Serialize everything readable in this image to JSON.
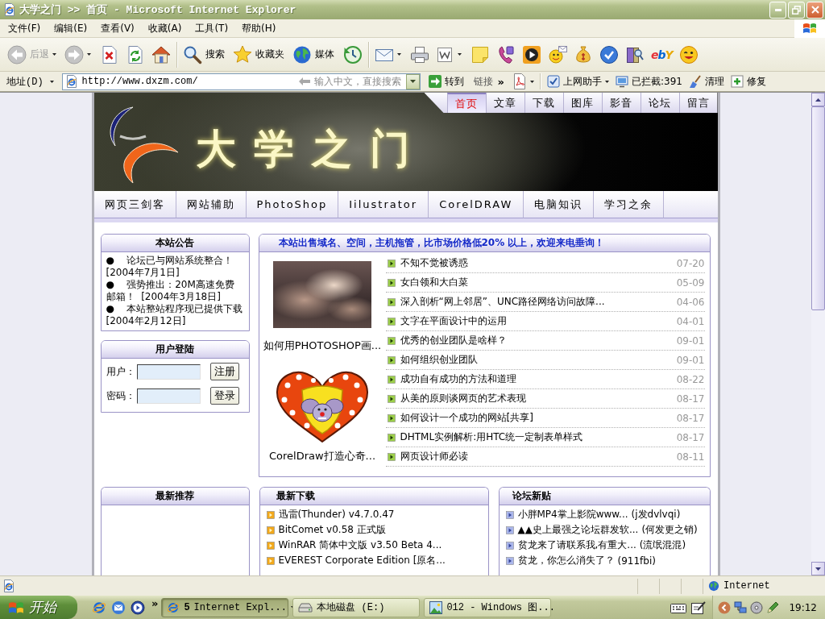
{
  "window": {
    "title": "大学之门 >> 首页 - Microsoft Internet Explorer"
  },
  "menu": [
    "文件(F)",
    "编辑(E)",
    "查看(V)",
    "收藏(A)",
    "工具(T)",
    "帮助(H)"
  ],
  "toolbar": {
    "back": {
      "label": "后退",
      "disabled": true
    },
    "forward": {
      "disabled": true
    },
    "search": {
      "label": "搜索"
    },
    "favorites": {
      "label": "收藏夹"
    },
    "media": {
      "label": "媒体"
    },
    "logo": "ebY"
  },
  "address_bar": {
    "label": "地址(D)",
    "url": "http://www.dxzm.com/",
    "search": {
      "placeholder": "输入中文，直接搜索"
    },
    "go": "转到",
    "links": "链接",
    "more": "»",
    "helper": "上网助手",
    "blocked": "已拦截:391",
    "clean": "清理",
    "repair": "修复"
  },
  "site": {
    "logo": "大学之门",
    "top_nav": [
      {
        "label": "首页",
        "selected": true
      },
      {
        "label": "文章",
        "selected": false
      },
      {
        "label": "下载",
        "selected": false
      },
      {
        "label": "图库",
        "selected": false
      },
      {
        "label": "影音",
        "selected": false
      },
      {
        "label": "论坛",
        "selected": false
      },
      {
        "label": "留言",
        "selected": false
      }
    ],
    "categories": [
      "网页三剑客",
      "网站辅助",
      "PhotoShop",
      "Iilustrator",
      "CorelDRAW",
      "电脑知识",
      "学习之余"
    ],
    "notice": {
      "title": "本站公告",
      "items": [
        "●    论坛已与网站系统整合！  [2004年7月1日]",
        "●    强势推出：20M高速免费邮箱！  [2004年3月18日]",
        "●    本站整站程序现已提供下载 [2004年2月12日]"
      ]
    },
    "login": {
      "title": "用户登陆",
      "user_label": "用户：",
      "password_label": "密码：",
      "register": "注册",
      "login": "登录"
    },
    "promo": {
      "title": "本站出售域名、空间，主机拖管，比市场价格低20% 以上，欢迎来电垂询！",
      "pictures": [
        {
          "kind": "photo",
          "caption": "如何用PHOTOSHOP画..."
        },
        {
          "kind": "illustration",
          "caption": "CorelDraw打造心奇..."
        }
      ],
      "articles": [
        {
          "title": "不知不觉被诱惑",
          "date": "07-20"
        },
        {
          "title": "女白领和大白菜",
          "date": "05-09"
        },
        {
          "title": "深入剖析“网上邻居”、UNC路径网络访问故障...",
          "date": "04-06"
        },
        {
          "title": "文字在平面设计中的运用",
          "date": "04-01"
        },
        {
          "title": "优秀的创业团队是啥样？",
          "date": "09-01"
        },
        {
          "title": "如何组织创业团队",
          "date": "09-01"
        },
        {
          "title": "成功自有成功的方法和道理",
          "date": "08-22"
        },
        {
          "title": "从美的原则谈网页的艺术表现",
          "date": "08-17"
        },
        {
          "title": "如何设计一个成功的网站[共享]",
          "date": "08-17"
        },
        {
          "title": "DHTML实例解析:用HTC统一定制表单样式",
          "date": "08-17"
        },
        {
          "title": "网页设计师必读",
          "date": "08-11"
        }
      ]
    },
    "recommended": {
      "title": "最新推荐"
    },
    "downloads": {
      "title": "最新下载",
      "items": [
        "迅雷(Thunder) v4.7.0.47",
        "BitComet v0.58 正式版",
        "WinRAR 简体中文版 v3.50 Beta 4...",
        "EVEREST Corporate Edition [原名..."
      ]
    },
    "forum": {
      "title": "论坛新贴",
      "posts": [
        {
          "title": "小胖MP4掌上影院www...",
          "author": "(j发dvlvqi)"
        },
        {
          "title": "▲▲史上最强之论坛群发软...",
          "author": "(何发更之销)"
        },
        {
          "title": "贫龙来了请联系我,有重大...",
          "author": "(流氓混混)"
        },
        {
          "title": "贫龙，你怎么消失了？",
          "author": "(911fbi)"
        }
      ]
    }
  },
  "status_bar": {
    "zone": "Internet"
  },
  "taskbar": {
    "start": "开始",
    "more": "»",
    "tasks": [
      {
        "kind": "browser",
        "count": "5",
        "label": "Internet Expl...",
        "selected": true
      },
      {
        "kind": "drive",
        "label": "本地磁盘 (E:)",
        "selected": false
      },
      {
        "kind": "image",
        "label": "012 - Windows 图...",
        "selected": false
      }
    ],
    "clock": "19:12"
  }
}
